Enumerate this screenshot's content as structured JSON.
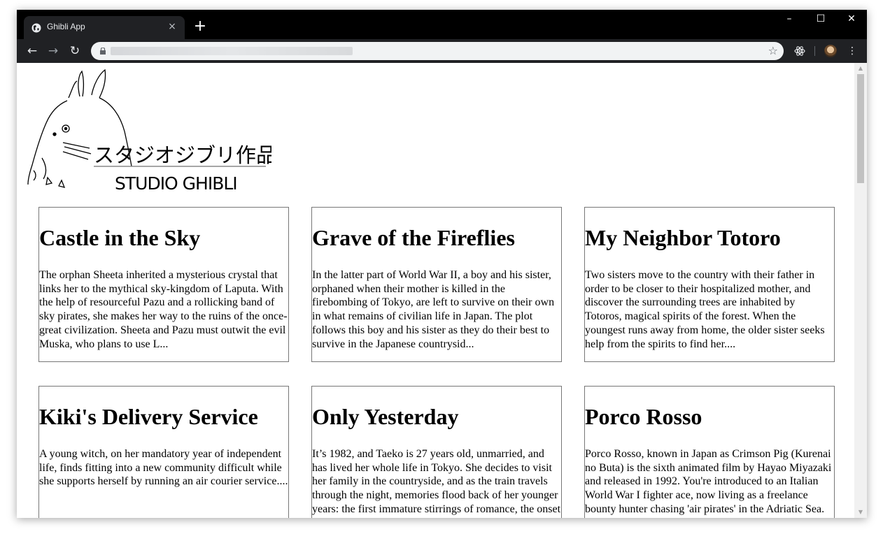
{
  "browser": {
    "tab_title": "Ghibli App",
    "tab_close": "×",
    "new_tab": "+",
    "minimize": "–",
    "maximize": "☐",
    "close": "✕",
    "back": "←",
    "forward": "→",
    "reload": "↻",
    "bookmark_star": "☆",
    "menu": "⋮"
  },
  "logo": {
    "japanese": "スタジオジブリ作品",
    "english": "STUDIO GHIBLI"
  },
  "films": [
    {
      "title": "Castle in the Sky",
      "description": "The orphan Sheeta inherited a mysterious crystal that links her to the mythical sky-kingdom of Laputa. With the help of resourceful Pazu and a rollicking band of sky pirates, she makes her way to the ruins of the once-great civilization. Sheeta and Pazu must outwit the evil Muska, who plans to use L..."
    },
    {
      "title": "Grave of the Fireflies",
      "description": "In the latter part of World War II, a boy and his sister, orphaned when their mother is killed in the firebombing of Tokyo, are left to survive on their own in what remains of civilian life in Japan. The plot follows this boy and his sister as they do their best to survive in the Japanese countrysid..."
    },
    {
      "title": "My Neighbor Totoro",
      "description": "Two sisters move to the country with their father in order to be closer to their hospitalized mother, and discover the surrounding trees are inhabited by Totoros, magical spirits of the forest. When the youngest runs away from home, the older sister seeks help from the spirits to find her...."
    },
    {
      "title": "Kiki's Delivery Service",
      "description": "A young witch, on her mandatory year of independent life, finds fitting into a new community difficult while she supports herself by running an air courier service...."
    },
    {
      "title": "Only Yesterday",
      "description": "It’s 1982, and Taeko is 27 years old, unmarried, and has lived her whole life in Tokyo. She decides to visit her family in the countryside, and as the train travels through the night, memories flood back of her younger years: the first immature stirrings of romance, the onset"
    },
    {
      "title": "Porco Rosso",
      "description": "Porco Rosso, known in Japan as Crimson Pig (Kurenai no Buta) is the sixth animated film by Hayao Miyazaki and released in 1992. You're introduced to an Italian World War I fighter ace, now living as a freelance bounty hunter chasing 'air pirates' in the Adriatic Sea. He"
    }
  ]
}
